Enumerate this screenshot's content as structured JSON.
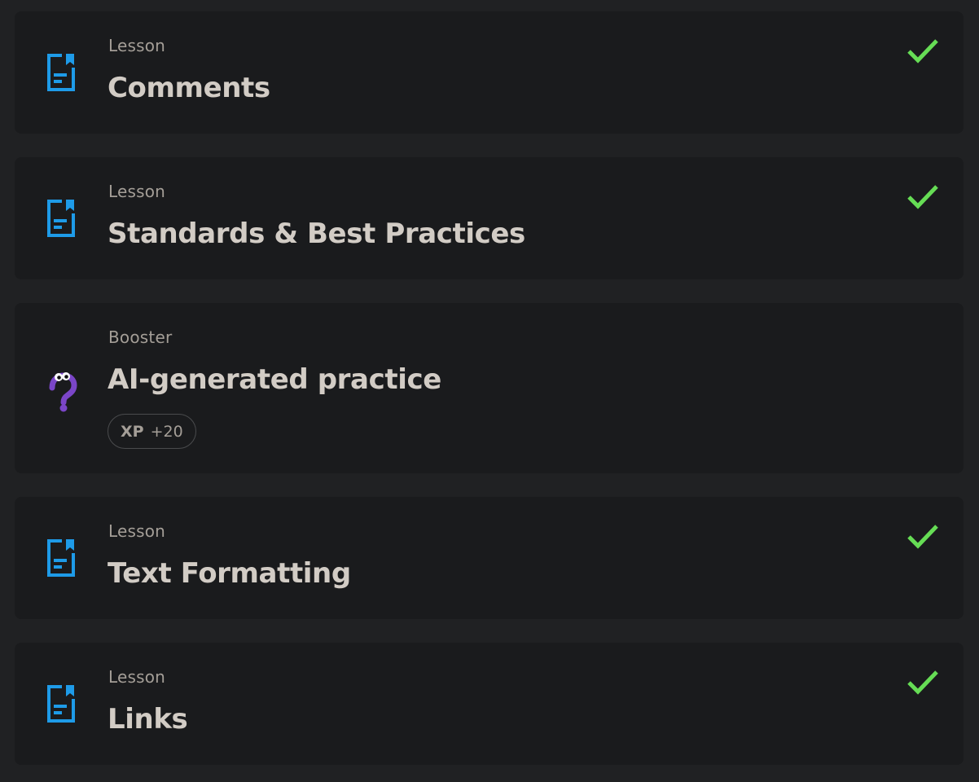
{
  "items": [
    {
      "type": "Lesson",
      "title": "Comments",
      "completed": true,
      "icon": "lesson-document-icon"
    },
    {
      "type": "Lesson",
      "title": "Standards & Best Practices",
      "completed": true,
      "icon": "lesson-document-icon"
    },
    {
      "type": "Booster",
      "title": "AI-generated practice",
      "completed": false,
      "icon": "question-mark-mascot-icon",
      "xp": {
        "label": "XP",
        "value": "+20"
      }
    },
    {
      "type": "Lesson",
      "title": "Text Formatting",
      "completed": true,
      "icon": "lesson-document-icon"
    },
    {
      "type": "Lesson",
      "title": "Links",
      "completed": true,
      "icon": "lesson-document-icon"
    }
  ],
  "colors": {
    "background": "#202123",
    "card": "#1a1b1d",
    "lesson_icon": "#1e9be8",
    "check": "#66dd55",
    "booster_icon": "#7b46c8"
  }
}
